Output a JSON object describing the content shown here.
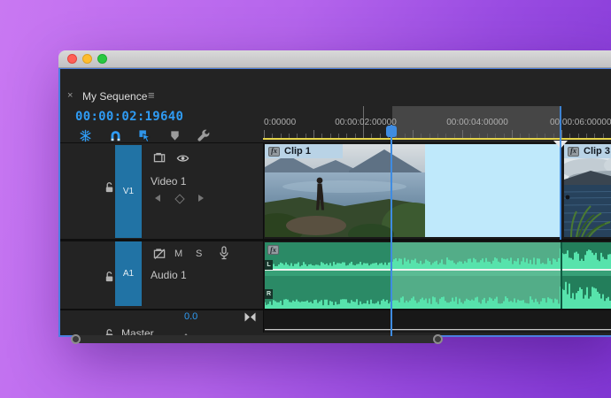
{
  "window": {
    "tab_title": "My Sequence",
    "close_glyph": "×",
    "panel_menu_glyph": "≡"
  },
  "playback": {
    "timecode": "00:00:02:19640"
  },
  "ruler": {
    "labels": [
      "0:00000",
      "00:00:02:00000",
      "00:00:04:00000",
      "00:00:06:00000"
    ]
  },
  "tracks": {
    "video": {
      "id": "V1",
      "name": "Video 1"
    },
    "audio": {
      "id": "A1",
      "name": "Audio 1",
      "mute_label": "M",
      "solo_label": "S",
      "channel_left": "L",
      "channel_right": "R"
    },
    "master": {
      "name": "Master",
      "volume": "0.0"
    }
  },
  "clips": {
    "fx_badge": "fx",
    "video_clip1_label": "Clip 1",
    "video_clip3_label": "Clip 3"
  },
  "colors": {
    "accent_blue": "#2f9bf3",
    "track_bar_blue": "#2173a5",
    "selected_clip_cyan": "#bfe9fb",
    "audio_clip_green": "#2b8a66",
    "waveform_mint": "#57e3ac",
    "render_bar_yellow": "#e5d44a",
    "clip_header_blue": "#b9d3e6",
    "desktop_purple": "#a855e8",
    "traffic_red": "#ff5f57",
    "traffic_yellow": "#febc2e",
    "traffic_green": "#28c840"
  }
}
